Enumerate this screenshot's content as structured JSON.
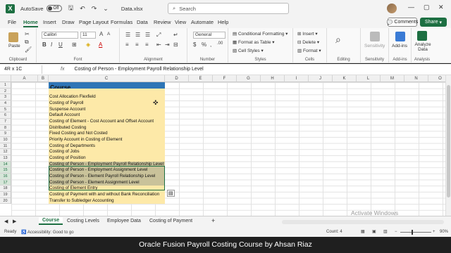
{
  "titlebar": {
    "autosave_label": "AutoSave",
    "autosave_state": "Off",
    "filename": "Data.xlsx",
    "search_placeholder": "Search"
  },
  "menu": {
    "tabs": [
      "File",
      "Home",
      "Insert",
      "Draw",
      "Page Layout",
      "Formulas",
      "Data",
      "Review",
      "View",
      "Automate",
      "Help"
    ],
    "active": "Home",
    "comments": "Comments",
    "share": "Share"
  },
  "ribbon": {
    "paste": "Paste",
    "clipboard": "Clipboard",
    "font_name": "Calibri",
    "font_size": "11",
    "font_group": "Font",
    "alignment": "Alignment",
    "number_format": "General",
    "number": "Number",
    "conditional_formatting": "Conditional Formatting",
    "format_as_table": "Format as Table",
    "cell_styles": "Cell Styles",
    "styles": "Styles",
    "insert": "Insert",
    "delete": "Delete",
    "format": "Format",
    "cells": "Cells",
    "editing": "Editing",
    "sensitivity": "Sensitivity",
    "addins": "Add-ins",
    "analyze_data": "Analyze Data",
    "analysis": "Analysis"
  },
  "formula_bar": {
    "name_box": "4R x 1C",
    "fx": "fx",
    "content": "Costing of Person - Employment Payroll Relationship Level"
  },
  "columns": [
    "A",
    "B",
    "C",
    "D",
    "E",
    "F",
    "G",
    "H",
    "I",
    "J",
    "K",
    "L",
    "M",
    "N",
    "O",
    "P"
  ],
  "rows": [
    "1",
    "2",
    "3",
    "4",
    "5",
    "6",
    "7",
    "8",
    "9",
    "10",
    "11",
    "12",
    "13",
    "14",
    "15",
    "16",
    "17",
    "18",
    "19",
    "20"
  ],
  "sheet": {
    "header": "Course",
    "items": [
      "Cost Allocation Flexfield",
      "Costing of Payroll",
      "Suspense Account",
      "Default Account",
      "Costing of Element - Cost Account and Offset Account",
      "Distributed Costing",
      "Fixed Costing and Not Costed",
      "Priority Account in Costing of Element",
      "Costing of Departments",
      "Costing of Jobs",
      "Costing of Position",
      "Costing of Person - Employment Payroll Relationship Level",
      "Costing of Person - Employment Assignment Level",
      "Costing of Person - Element Payroll Relationship Level",
      "Costing of Person - Element Assignment Level",
      "Costing of Element Entry",
      "Costing of Payment with and without Bank Reconciliation",
      "Transfer to Subledger Accounting"
    ]
  },
  "sheet_tabs": [
    "Course",
    "Costing Levels",
    "Employee Data",
    "Costing of Payment"
  ],
  "active_sheet": "Course",
  "status": {
    "ready": "Ready",
    "accessibility": "Accessibility: Good to go",
    "count": "Count: 4",
    "zoom": "90%"
  },
  "watermark": "Activate Windows",
  "caption": "Oracle Fusion Payroll Costing Course by Ahsan Riaz"
}
